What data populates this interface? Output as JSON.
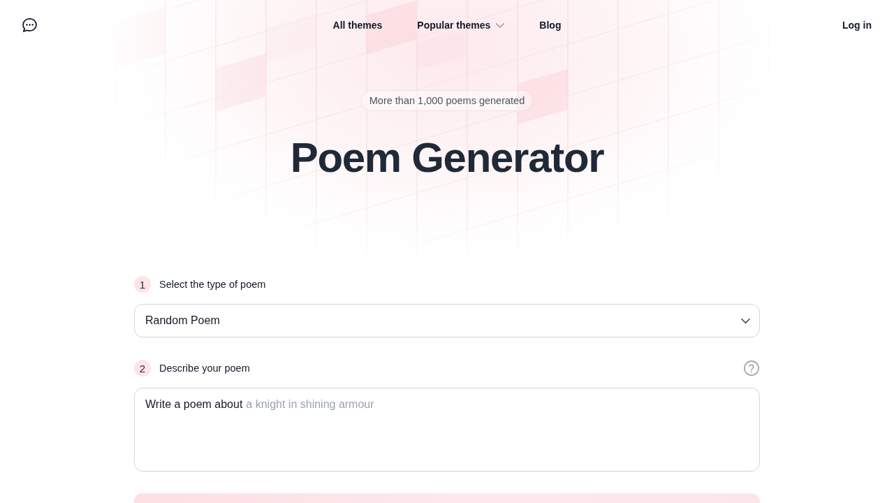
{
  "header": {
    "nav": [
      {
        "label": "All themes",
        "kind": "link"
      },
      {
        "label": "Popular themes",
        "kind": "dropdown"
      },
      {
        "label": "Blog",
        "kind": "link"
      }
    ],
    "login": "Log in"
  },
  "hero": {
    "badge": "More than 1,000 poems generated",
    "title": "Poem Generator"
  },
  "steps": [
    {
      "number": "1",
      "label": "Select the type of poem",
      "kind": "select",
      "help": false,
      "value": "Random Poem"
    },
    {
      "number": "2",
      "label": "Describe your poem",
      "kind": "textarea",
      "help": true,
      "prefix": "Write a poem about",
      "placeholder": "a knight in shining armour"
    }
  ]
}
